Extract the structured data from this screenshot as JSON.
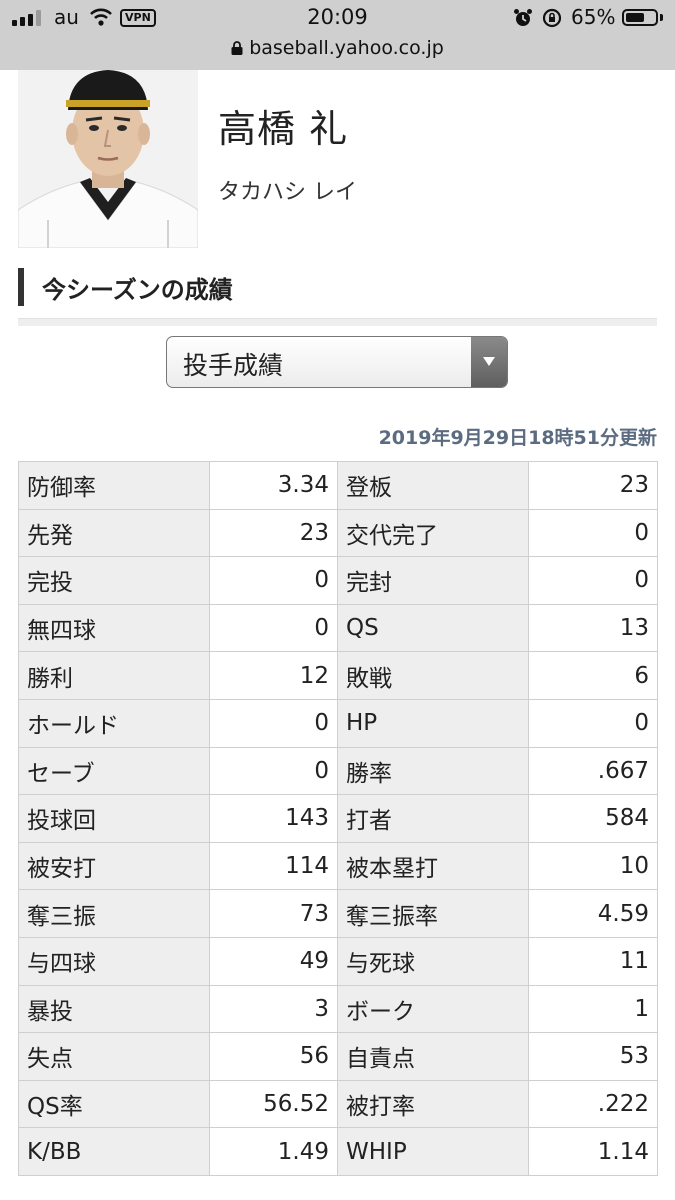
{
  "status_bar": {
    "carrier": "au",
    "vpn": "VPN",
    "time": "20:09",
    "battery": "65%",
    "battery_level": 0.65,
    "url": "baseball.yahoo.co.jp"
  },
  "player": {
    "name": "高橋 礼",
    "kana": "タカハシ レイ"
  },
  "section": {
    "title": "今シーズンの成績",
    "select_value": "投手成績",
    "updated": "2019年9月29日18時51分更新"
  },
  "stats": [
    {
      "l1": "防御率",
      "v1": "3.34",
      "l2": "登板",
      "v2": "23"
    },
    {
      "l1": "先発",
      "v1": "23",
      "l2": "交代完了",
      "v2": "0"
    },
    {
      "l1": "完投",
      "v1": "0",
      "l2": "完封",
      "v2": "0"
    },
    {
      "l1": "無四球",
      "v1": "0",
      "l2": "QS",
      "v2": "13"
    },
    {
      "l1": "勝利",
      "v1": "12",
      "l2": "敗戦",
      "v2": "6"
    },
    {
      "l1": "ホールド",
      "v1": "0",
      "l2": "HP",
      "v2": "0"
    },
    {
      "l1": "セーブ",
      "v1": "0",
      "l2": "勝率",
      "v2": ".667"
    },
    {
      "l1": "投球回",
      "v1": "143",
      "l2": "打者",
      "v2": "584"
    },
    {
      "l1": "被安打",
      "v1": "114",
      "l2": "被本塁打",
      "v2": "10"
    },
    {
      "l1": "奪三振",
      "v1": "73",
      "l2": "奪三振率",
      "v2": "4.59"
    },
    {
      "l1": "与四球",
      "v1": "49",
      "l2": "与死球",
      "v2": "11"
    },
    {
      "l1": "暴投",
      "v1": "3",
      "l2": "ボーク",
      "v2": "1"
    },
    {
      "l1": "失点",
      "v1": "56",
      "l2": "自責点",
      "v2": "53"
    },
    {
      "l1": "QS率",
      "v1": "56.52",
      "l2": "被打率",
      "v2": ".222"
    },
    {
      "l1": "K/BB",
      "v1": "1.49",
      "l2": "WHIP",
      "v2": "1.14"
    }
  ]
}
